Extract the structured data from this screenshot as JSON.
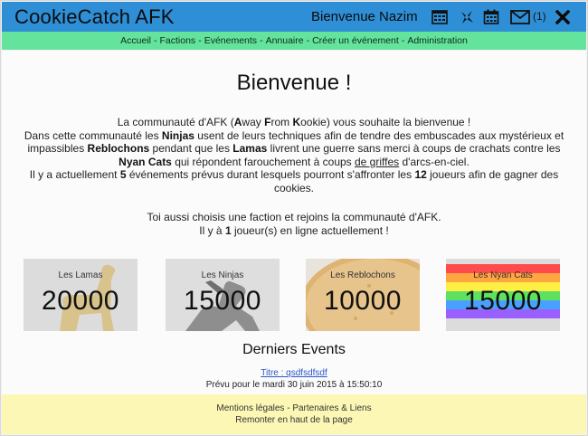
{
  "header": {
    "app_title": "CookieCatch AFK",
    "welcome": "Bienvenue Nazim",
    "message_count": "(1)",
    "icons": [
      "calendar-grid-icon",
      "ninja-icon",
      "calendar-icon",
      "mail-icon",
      "close-icon"
    ]
  },
  "nav": {
    "items": [
      "Accueil",
      "Factions",
      "Evénements",
      "Annuaire",
      "Créer un événement",
      "Administration"
    ],
    "separator": "-"
  },
  "main": {
    "heading": "Bienvenue !",
    "intro": {
      "line1_prefix": "La communauté d'AFK (",
      "line1_a": "A",
      "line1_way": "way ",
      "line1_f": "F",
      "line1_rom": "rom ",
      "line1_k": "K",
      "line1_suffix": "ookie) vous souhaite la bienvenue !",
      "line2_a": "Dans cette communauté les ",
      "ninjas": "Ninjas",
      "line2_b": " usent de leurs techniques afin de tendre des embuscades aux mystérieux et",
      "line3_a": "impassibles ",
      "reblochons": "Reblochons",
      "line3_b": " pendant que les ",
      "lamas": "Lamas",
      "line3_c": " livrent une guerre sans merci à coups de crachats contre les",
      "nyan_cats": "Nyan Cats",
      "line4_a": " qui répondent farouchement à coups ",
      "de_griffes": "de griffes",
      "line4_b": " d'arcs-en-ciel.",
      "line5_a": "Il y a actuellement ",
      "events_count": "5",
      "line5_b": " événements prévus durant lesquels pourront s'affronter les ",
      "players_count": "12",
      "line5_c": " joueurs afin de gagner des",
      "line6": "cookies."
    },
    "join": {
      "line1": "Toi aussi choisis une faction et rejoins la communauté d'AFK.",
      "line2_a": "Il y à ",
      "online_count": "1",
      "line2_b": " joueur(s) en ligne actuellement !"
    }
  },
  "factions": [
    {
      "name": "Les Lamas",
      "count": "20000",
      "bg": "#dcdcdc",
      "art": "#d7c38b"
    },
    {
      "name": "Les Ninjas",
      "count": "15000",
      "bg": "#dedede",
      "art": "#8c8c8c"
    },
    {
      "name": "Les Reblochons",
      "count": "10000",
      "bg": "#e6e2da",
      "art": "#e0b878"
    },
    {
      "name": "Les Nyan Cats",
      "count": "15000",
      "bg": "#dcdcdc",
      "art": "rainbow"
    }
  ],
  "events": {
    "title": "Derniers Events",
    "event_link": "Titre : qsdfsdfsdf",
    "event_date": "Prévu pour le mardi 30 juin 2015 à 15:50:10"
  },
  "footer": {
    "links_line": "Mentions légales - Partenaires & Liens",
    "back_to_top": "Remonter en haut de la page"
  },
  "colors": {
    "header_bg": "#2f8fd6",
    "nav_bg": "#63e39b",
    "footer_bg": "#fdf7b6",
    "link": "#2a56c6"
  }
}
